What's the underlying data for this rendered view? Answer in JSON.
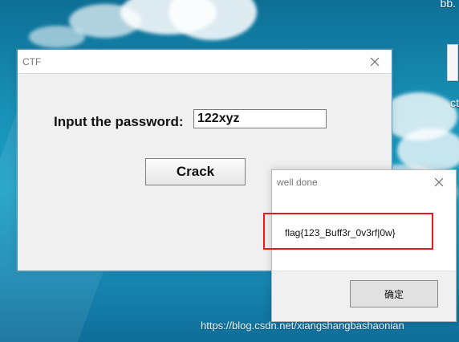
{
  "desktop": {
    "top_label": "bb.",
    "icon_label": "ct"
  },
  "ctf_window": {
    "title": "CTF",
    "input_label": "Input the password:",
    "input_value": "122xyz",
    "crack_label": "Crack"
  },
  "message_box": {
    "title": "well done",
    "message": "flag{123_Buff3r_0v3rf|0w}",
    "ok_label": "确定"
  },
  "footer": {
    "watermark": "https://blog.csdn.net/xiangshangbashaonian"
  },
  "icons": {
    "close": "close-icon",
    "file": "file-icon"
  },
  "colors": {
    "accent_blue": "#1ca0c7",
    "highlight_red": "#e41b1b",
    "window_gray": "#f0f0f0"
  }
}
